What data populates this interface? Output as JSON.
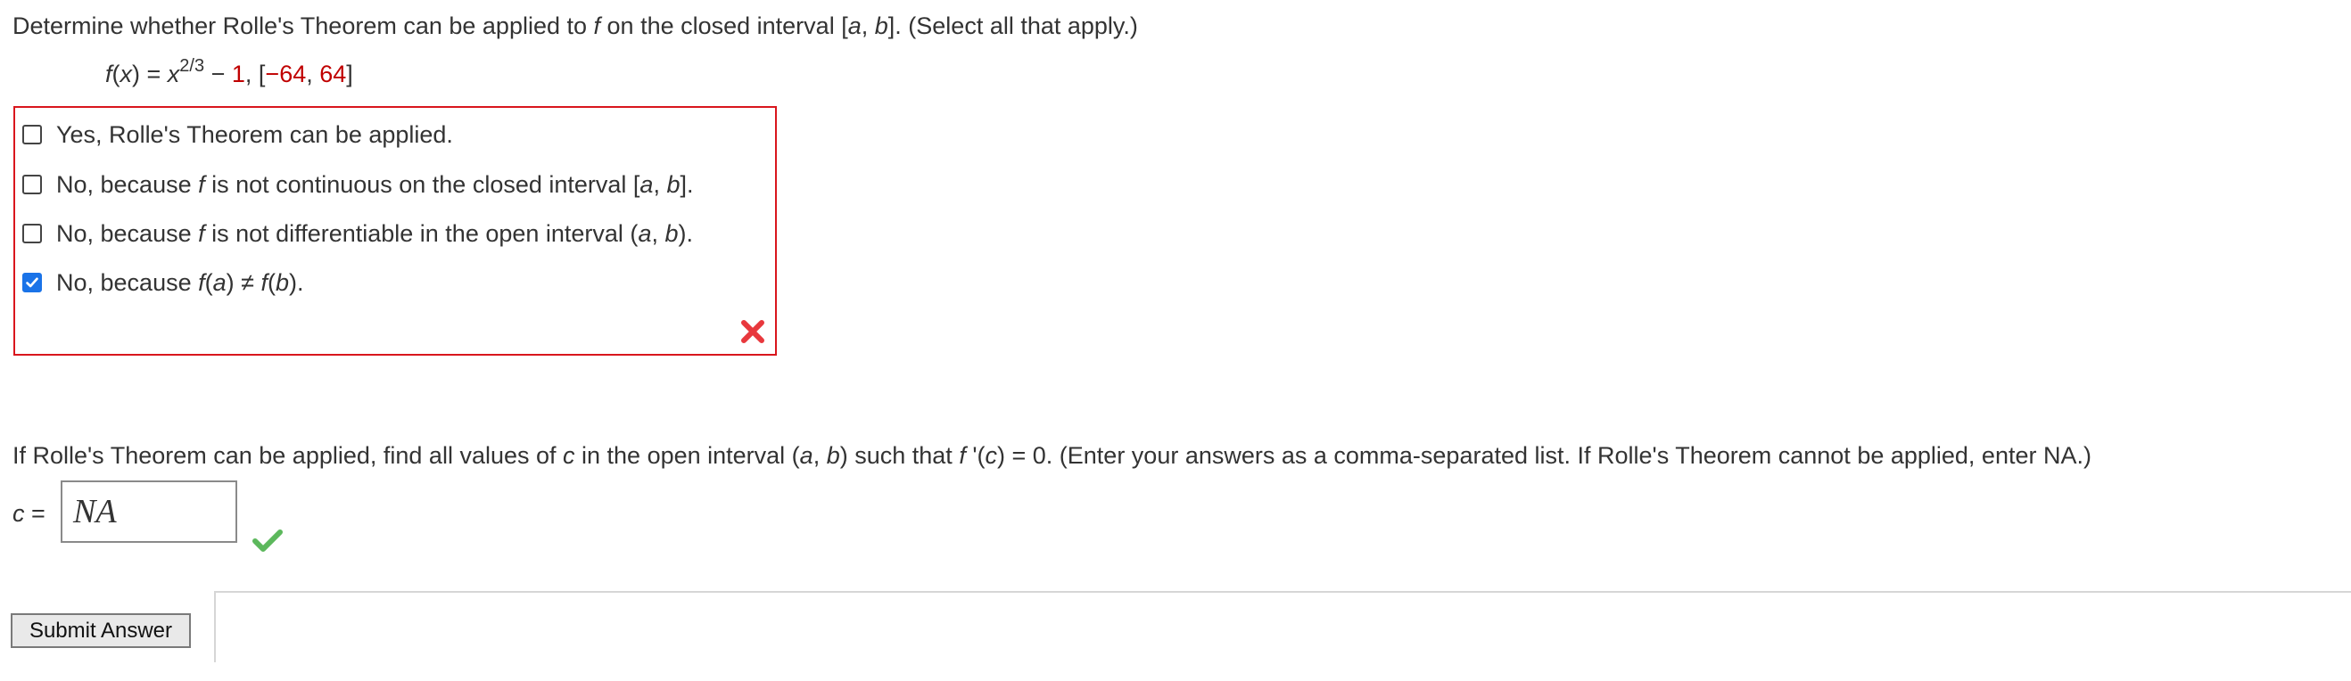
{
  "question1": {
    "p1": "Determine whether Rolle's Theorem can be applied to ",
    "f": "f",
    "p2": " on the closed interval [",
    "a": "a",
    "comma": ", ",
    "b": "b",
    "p3": "]. (Select all that apply.)"
  },
  "function": {
    "f": "f",
    "open": "(",
    "x": "x",
    "close": ") = ",
    "base": "x",
    "exp": "2/3",
    "minus": " − ",
    "const": "1",
    "sep": ",    [",
    "lo": "−64",
    "comma": ", ",
    "hi": "64",
    "end": "]"
  },
  "options": [
    {
      "text": "Yes, Rolle's Theorem can be applied.",
      "checked": false
    },
    {
      "pre": "No, because ",
      "f": "f",
      "mid": " is not continuous on the closed interval [",
      "a": "a",
      "comma": ", ",
      "b": "b",
      "post": "].",
      "checked": false
    },
    {
      "pre": "No, because ",
      "f": "f",
      "mid": " is not differentiable in the open interval (",
      "a": "a",
      "comma": ", ",
      "b": "b",
      "post": ").",
      "checked": false
    },
    {
      "pre": "No, because ",
      "fa": "f",
      "a_open": "(",
      "a": "a",
      "a_close": ")",
      "neq": " ≠ ",
      "fb": "f",
      "b_open": "(",
      "b": "b",
      "b_close": ").",
      "checked": true
    }
  ],
  "feedback1": {
    "status": "incorrect",
    "icon": "x-icon",
    "color": "#e8383d"
  },
  "question2": {
    "p1": "If Rolle's Theorem can be applied, find all values of ",
    "c": "c",
    "p2": " in the open interval (",
    "a": "a",
    "comma": ", ",
    "b": "b",
    "p3": ") such that ",
    "f": "f",
    "p4": " '(",
    "c2": "c",
    "p5": ") = 0. (Enter your answers as a comma-separated list. If Rolle's Theorem cannot be applied, enter NA.)"
  },
  "answer": {
    "label_c": "c",
    "label_eq": " =",
    "value": "NA"
  },
  "feedback2": {
    "status": "correct",
    "icon": "check-icon",
    "color": "#5cb85c"
  },
  "submit_label": "Submit Answer",
  "accent_color": "#1a73e8",
  "error_border_color": "#d9161d",
  "param_color": "#c00000"
}
